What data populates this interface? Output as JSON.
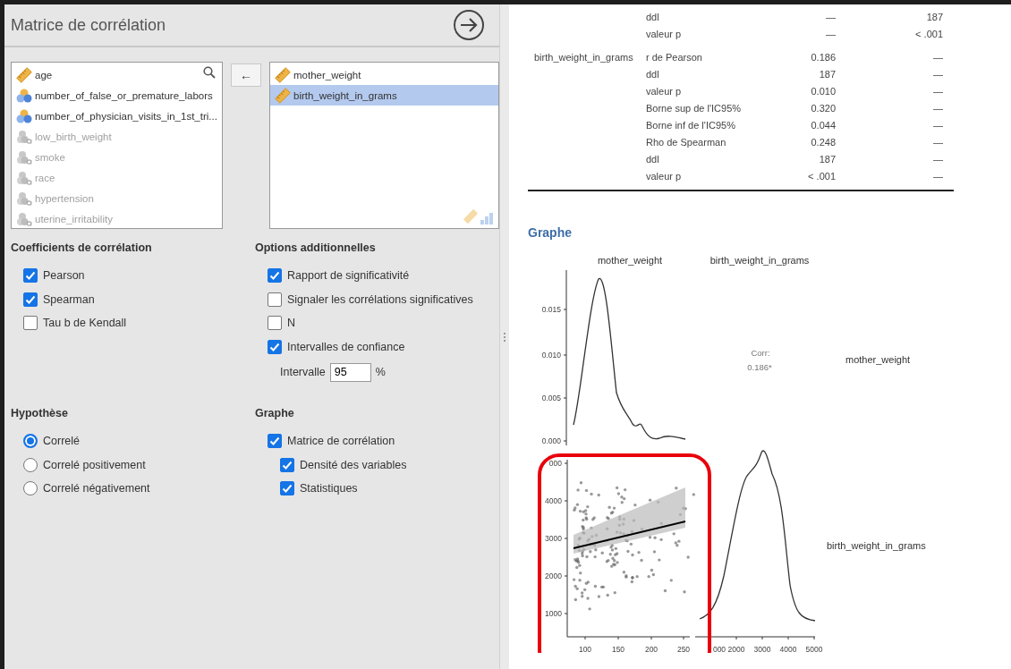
{
  "options_panel": {
    "title": "Matrice de corrélation",
    "available_variables": [
      {
        "name": "age",
        "kind": "continuous",
        "disabled": false
      },
      {
        "name": "number_of_false_or_premature_labors",
        "kind": "ordinal",
        "disabled": false
      },
      {
        "name": "number_of_physician_visits_in_1st_tri...",
        "kind": "ordinal",
        "disabled": false
      },
      {
        "name": "low_birth_weight",
        "kind": "text",
        "disabled": true
      },
      {
        "name": "smoke",
        "kind": "text",
        "disabled": true
      },
      {
        "name": "race",
        "kind": "text",
        "disabled": true
      },
      {
        "name": "hypertension",
        "kind": "text",
        "disabled": true
      },
      {
        "name": "uterine_irritability",
        "kind": "text",
        "disabled": true
      }
    ],
    "move_button": "←",
    "selected_variables": [
      {
        "name": "mother_weight",
        "kind": "continuous",
        "selected": false
      },
      {
        "name": "birth_weight_in_grams",
        "kind": "continuous",
        "selected": true
      }
    ],
    "coefficients": {
      "heading": "Coefficients de corrélation",
      "options": [
        {
          "label": "Pearson",
          "checked": true
        },
        {
          "label": "Spearman",
          "checked": true
        },
        {
          "label": "Tau b de Kendall",
          "checked": false
        }
      ]
    },
    "additional": {
      "heading": "Options additionnelles",
      "options": [
        {
          "label": "Rapport de significativité",
          "checked": true
        },
        {
          "label": "Signaler les corrélations significatives",
          "checked": false
        },
        {
          "label": "N",
          "checked": false
        },
        {
          "label": "Intervalles de confiance",
          "checked": true
        }
      ],
      "interval": {
        "label": "Intervalle",
        "value": "95",
        "unit": "%"
      }
    },
    "hypothesis": {
      "heading": "Hypothèse",
      "options": [
        {
          "label": "Correlé",
          "selected": true
        },
        {
          "label": "Correlé positivement",
          "selected": false
        },
        {
          "label": "Correlé négativement",
          "selected": false
        }
      ]
    },
    "plot_options": {
      "heading": "Graphe",
      "options": [
        {
          "label": "Matrice de corrélation",
          "checked": true,
          "children": [
            {
              "label": "Densité des variables",
              "checked": true
            },
            {
              "label": "Statistiques",
              "checked": true
            }
          ]
        }
      ]
    }
  },
  "results": {
    "table": {
      "groups": [
        {
          "rows": [
            {
              "statistic": "ddl",
              "column_1": "—",
              "column_2": "187"
            },
            {
              "statistic": "valeur p",
              "column_1": "—",
              "column_2": "< .001"
            }
          ]
        },
        {
          "variable": "birth_weight_in_grams",
          "rows": [
            {
              "statistic": "r de Pearson",
              "column_1": "0.186",
              "column_2": "—"
            },
            {
              "statistic": "ddl",
              "column_1": "187",
              "column_2": "—"
            },
            {
              "statistic": "valeur p",
              "column_1": "0.010",
              "column_2": "—"
            },
            {
              "statistic": "Borne sup de l'IC95%",
              "column_1": "0.320",
              "column_2": "—"
            },
            {
              "statistic": "Borne inf de l'IC95%",
              "column_1": "0.044",
              "column_2": "—"
            },
            {
              "statistic": "Rho de Spearman",
              "column_1": "0.248",
              "column_2": "—"
            },
            {
              "statistic": "ddl",
              "column_1": "187",
              "column_2": "—"
            },
            {
              "statistic": "valeur p",
              "column_1": "< .001",
              "column_2": "—"
            }
          ]
        }
      ]
    },
    "plot": {
      "heading": "Graphe",
      "column_headers": [
        "mother_weight",
        "birth_weight_in_grams"
      ],
      "row_headers": [
        "mother_weight",
        "birth_weight_in_grams"
      ],
      "corr_label": "Corr:",
      "corr_value": "0.186*",
      "density_y_ticks": [
        "0.015",
        "0.010",
        "0.005",
        "0.000"
      ],
      "scatter_y_ticks": [
        "000",
        "4000",
        "3000",
        "2000",
        "1000"
      ],
      "scatter_x_ticks": [
        "100",
        "150",
        "200",
        "250"
      ],
      "density_x_ticks": [
        "000",
        "2000",
        "3000",
        "4000",
        "5000"
      ]
    }
  }
}
